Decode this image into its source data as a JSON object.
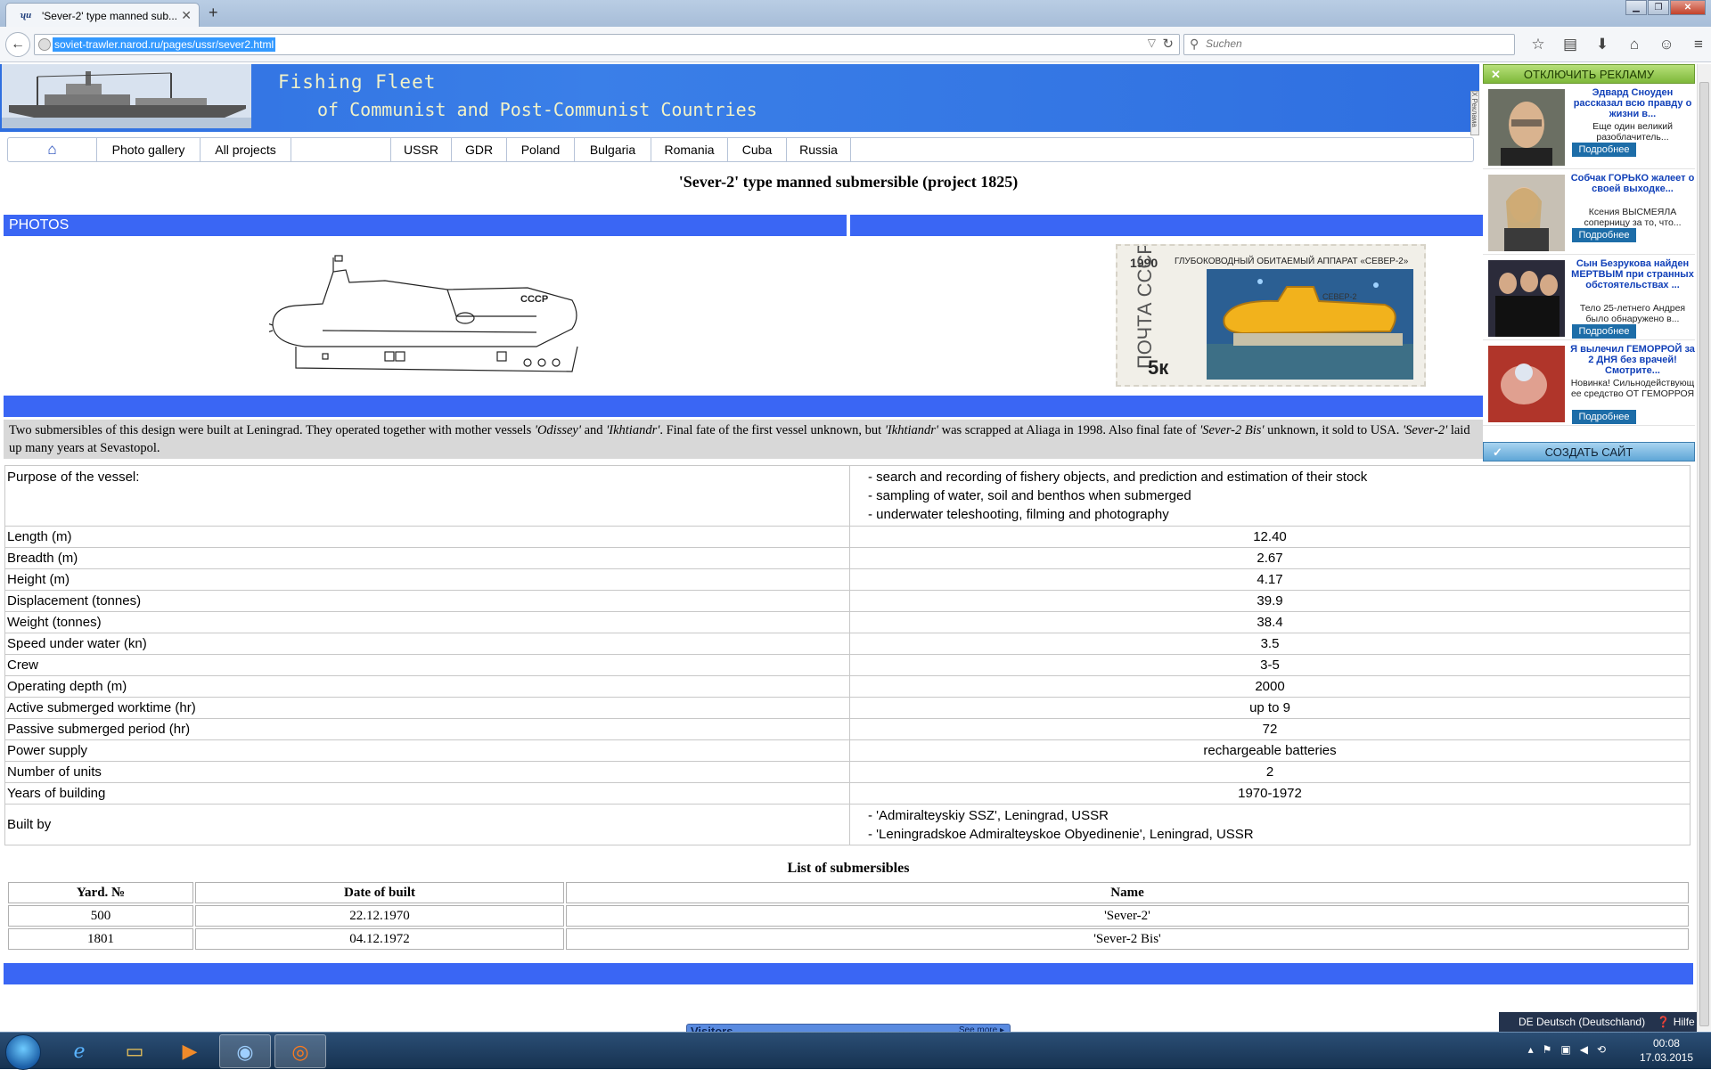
{
  "browser": {
    "tab_title": "'Sever-2' type manned sub...",
    "tab_favicon": "ship-favicon",
    "url": "soviet-trawler.narod.ru/pages/ussr/sever2.html",
    "search_placeholder": "Suchen"
  },
  "site": {
    "title_line1": "Fishing Fleet",
    "title_line2": "of Communist and Post-Communist Countries",
    "ad_tag": "Х Реклама",
    "menu": [
      {
        "label": "",
        "icon": "home-icon"
      },
      {
        "label": "Photo gallery"
      },
      {
        "label": "All projects"
      },
      {
        "label": ""
      },
      {
        "label": "USSR"
      },
      {
        "label": "GDR"
      },
      {
        "label": "Poland"
      },
      {
        "label": "Bulgaria"
      },
      {
        "label": "Romania"
      },
      {
        "label": "Cuba"
      },
      {
        "label": "Russia"
      }
    ]
  },
  "page": {
    "title": "'Sever-2' type manned submersible (project 1825)",
    "photos_label": "PHOTOS",
    "stamp": {
      "year": "1990",
      "caption": "ГЛУБОКОВОДНЫЙ ОБИТАЕМЫЙ АППАРАТ «СЕВЕР-2»",
      "country": "ПОЧТА СССР",
      "value": "5к",
      "hull_label": "СЕВЕР-2"
    },
    "drawing_label": "СССР",
    "description_parts": [
      "Two submersibles of this design were built at Leningrad. They operated together with mother vessels ",
      "'Odissey'",
      " and ",
      "'Ikhtiandr'",
      ". Final fate of the first vessel unknown, but ",
      "'Ikhtiandr'",
      " was scrapped at Aliaga in 1998. Also final fate of ",
      "'Sever-2 Bis'",
      " unknown, it sold to USA. ",
      "'Sever-2'",
      " laid up many years at Sevastopol."
    ],
    "specs": [
      {
        "key": "Purpose of the vessel:",
        "list": [
          "- search and recording of fishery objects, and prediction and estimation of their stock",
          "- sampling of water, soil and benthos when submerged",
          "- underwater teleshooting, filming and photography"
        ]
      },
      {
        "key": "Length (m)",
        "value": "12.40"
      },
      {
        "key": "Breadth (m)",
        "value": "2.67"
      },
      {
        "key": "Height (m)",
        "value": "4.17"
      },
      {
        "key": "Displacement (tonnes)",
        "value": "39.9"
      },
      {
        "key": "Weight (tonnes)",
        "value": "38.4"
      },
      {
        "key": "Speed under water (kn)",
        "value": "3.5"
      },
      {
        "key": "Crew",
        "value": "3-5"
      },
      {
        "key": "Operating depth (m)",
        "value": "2000"
      },
      {
        "key": "Active submerged worktime (hr)",
        "value": "up to 9"
      },
      {
        "key": "Passive submerged period (hr)",
        "value": "72"
      },
      {
        "key": "Power supply",
        "value": "rechargeable batteries"
      },
      {
        "key": "Number of units",
        "value": "2"
      },
      {
        "key": "Years of building",
        "value": "1970-1972"
      },
      {
        "key": "Built by",
        "list": [
          "- 'Admiralteyskiy SSZ', Leningrad, USSR",
          "- 'Leningradskoe Admiralteyskoe Obyedinenie', Leningrad, USSR"
        ]
      }
    ],
    "list_title": "List of submersibles",
    "list_headers": [
      "Yard. №",
      "Date of built",
      "Name"
    ],
    "list_rows": [
      [
        "500",
        "22.12.1970",
        "'Sever-2'"
      ],
      [
        "1801",
        "04.12.1972",
        "'Sever-2 Bis'"
      ]
    ],
    "visitors_label": "Visitors",
    "see_more": "See more ▸"
  },
  "ad": {
    "off_label": "ОТКЛЮЧИТЬ РЕКЛАМУ",
    "create_label": "СОЗДАТЬ САЙТ",
    "items": [
      {
        "headline": "Эдвард Сноуден рассказал всю правду о жизни в...",
        "text": "Еще один великий разоблачитель...",
        "more": "Подробнее"
      },
      {
        "headline": "Собчак ГОРЬКО жалеет о своей выходке...",
        "text": "Ксения ВЫСМЕЯЛА соперницу за то, что...",
        "more": "Подробнее"
      },
      {
        "headline": "Сын Безрукова найден МЕРТВЫМ при странных обстоятельствах ...",
        "text": "Тело 25-летнего Андрея было обнаружено в...",
        "more": "Подробнее"
      },
      {
        "headline": "Я вылечил ГЕМОРРОЙ за 2 ДНЯ без врачей! Смотрите...",
        "text": "Новинка! Сильнодействующ ее средство ОТ ГЕМОРРОЯ",
        "more": "Подробнее"
      }
    ]
  },
  "os": {
    "language": "DE Deutsch (Deutschland)",
    "help": "Hilfe",
    "time": "00:08",
    "date": "17.03.2015"
  },
  "colors": {
    "page_bar_blue": "#3a66f4",
    "header_blue": "#2f6fe0",
    "desc_bg": "#d8d8d8"
  }
}
